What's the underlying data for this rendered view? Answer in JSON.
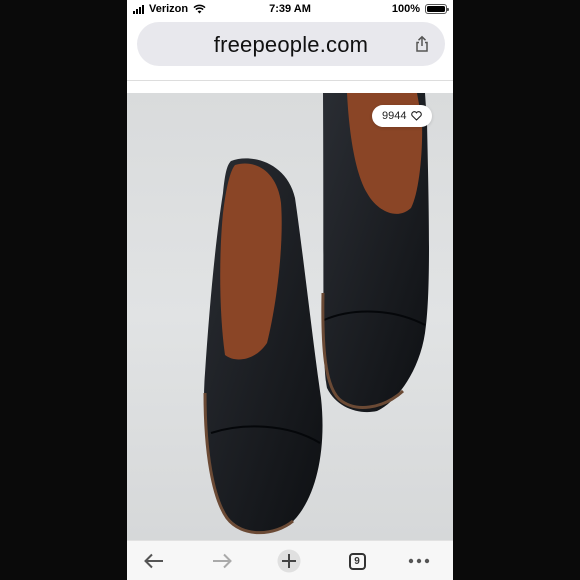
{
  "status_bar": {
    "carrier": "Verizon",
    "time": "7:39 AM",
    "battery": "100%",
    "signal_icon": "signal-bars-icon",
    "wifi_icon": "wifi-icon",
    "battery_icon": "battery-icon"
  },
  "address_bar": {
    "url": "freepeople.com",
    "share_icon": "share-icon"
  },
  "product_image": {
    "like_count": "9944",
    "like_icon": "heart-icon"
  },
  "toolbar": {
    "back_icon": "back-arrow-icon",
    "forward_icon": "forward-arrow-icon",
    "new_tab_icon": "plus-icon",
    "tab_count": "9",
    "more_icon": "more-icon"
  },
  "colors": {
    "url_bar_bg": "#e8e8ed",
    "shoe_leather": "#15171b",
    "shoe_lining": "#8a4526",
    "accent_blue": "#007aff"
  }
}
